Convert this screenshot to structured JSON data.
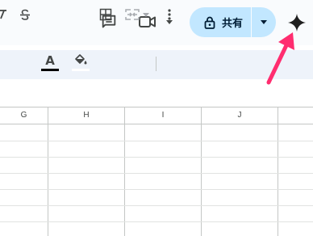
{
  "header": {
    "share_label": "共有",
    "accent_color": "#c2e7ff"
  },
  "toolbar": {
    "items": [
      "text-italic-icon",
      "strikethrough-icon",
      "text-color-icon",
      "fill-color-icon",
      "borders-icon",
      "merge-cells-icon",
      "more-vert-icon"
    ],
    "text_color_label": "A",
    "text_color": "#000000",
    "fill_color": "#ffffff"
  },
  "grid": {
    "columns": [
      "G",
      "H",
      "I",
      "J",
      ""
    ],
    "row_count": 7
  },
  "annotation": {
    "arrow_color": "#ff2d6f",
    "points_to": "gemini-icon"
  }
}
